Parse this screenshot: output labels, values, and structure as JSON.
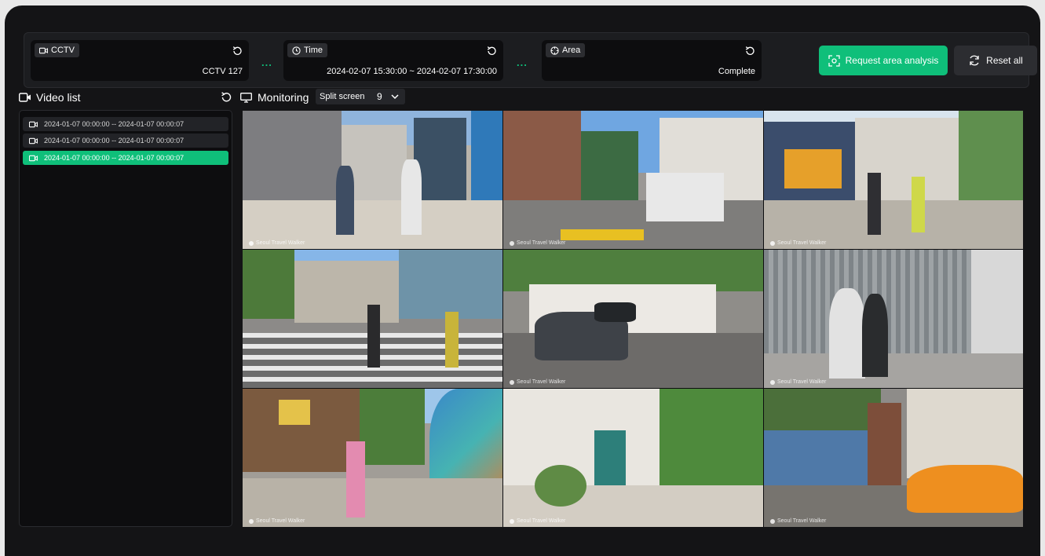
{
  "filters": {
    "cctv": {
      "label": "CCTV",
      "value": "CCTV 127"
    },
    "time": {
      "label": "Time",
      "value": "2024-02-07 15:30:00 ~ 2024-02-07 17:30:00"
    },
    "area": {
      "label": "Area",
      "value": "Complete"
    },
    "separator": "..."
  },
  "actions": {
    "request_label": "Request area analysis",
    "reset_all_label": "Reset all"
  },
  "video_list": {
    "title": "Video list",
    "items": [
      {
        "label": "2024-01-07 00:00:00 -- 2024-01-07 00:00:07",
        "active": false
      },
      {
        "label": "2024-01-07 00:00:00 -- 2024-01-07 00:00:07",
        "active": false
      },
      {
        "label": "2024-01-07 00:00:00 -- 2024-01-07 00:00:07",
        "active": true
      }
    ]
  },
  "monitoring": {
    "title": "Monitoring",
    "split_label": "Split screen",
    "split_value": "9"
  },
  "cameras": [
    {
      "watermark": "Seoul Travel Walker",
      "scene": "street-bus-stop"
    },
    {
      "watermark": "Seoul Travel Walker",
      "scene": "alley-truck"
    },
    {
      "watermark": "Seoul Travel Walker",
      "scene": "shop-street"
    },
    {
      "watermark": "",
      "scene": "crosswalk"
    },
    {
      "watermark": "Seoul Travel Walker",
      "scene": "parked-car"
    },
    {
      "watermark": "Seoul Travel Walker",
      "scene": "mural-wall"
    },
    {
      "watermark": "Seoul Travel Walker",
      "scene": "umbrella-street"
    },
    {
      "watermark": "Seoul Travel Walker",
      "scene": "cafe-front"
    },
    {
      "watermark": "Seoul Travel Walker",
      "scene": "garage-taxi"
    }
  ],
  "colors": {
    "accent": "#0fbf7a",
    "background": "#141416",
    "panel": "#0d0d0f"
  }
}
